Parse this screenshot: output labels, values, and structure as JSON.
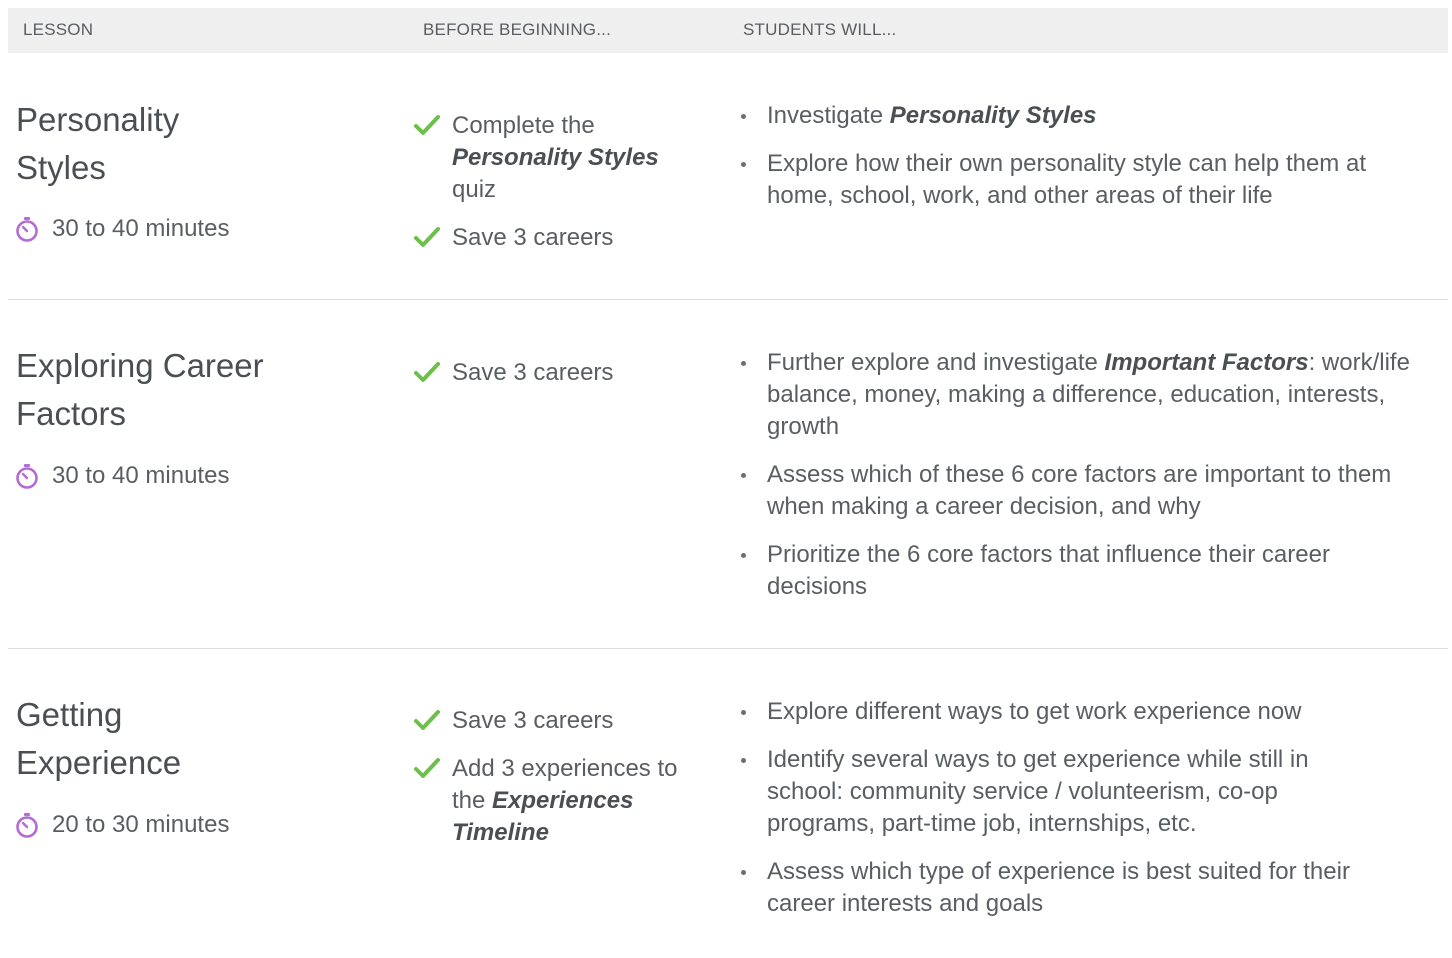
{
  "header": {
    "col_lesson": "LESSON",
    "col_before": "BEFORE BEGINNING...",
    "col_students": "STUDENTS WILL..."
  },
  "colors": {
    "check": "#6cc04a",
    "timer": "#b46bd6",
    "divider": "#dcdcdc",
    "header_bg": "#efefef"
  },
  "icons": {
    "check": "checkmark-icon",
    "timer": "stopwatch-icon",
    "bullet": "bullet-dot"
  },
  "lessons": [
    {
      "title_line1": "Personality",
      "title_line2": "Styles",
      "duration": "30 to 40 minutes",
      "prereqs": [
        {
          "pre": "Complete the",
          "em": "Personality Styles",
          "post": "quiz"
        },
        {
          "pre": "Save 3 careers",
          "em": "",
          "post": ""
        }
      ],
      "objectives": [
        {
          "pre": "Investigate ",
          "em": "Personality Styles",
          "post": ""
        },
        {
          "pre": "Explore how their own personality style can help them at home, school, work, and other areas of their life",
          "em": "",
          "post": ""
        }
      ]
    },
    {
      "title_line1": "Exploring Career",
      "title_line2": "Factors",
      "duration": "30 to 40 minutes",
      "prereqs": [
        {
          "pre": "Save 3 careers",
          "em": "",
          "post": ""
        }
      ],
      "objectives": [
        {
          "pre": "Further explore and investigate ",
          "em": "Important Factors",
          "post": ": work/life balance, money, making a difference, education, interests, growth"
        },
        {
          "pre": "Assess which of these 6 core factors are important to them when making a career decision, and why",
          "em": "",
          "post": ""
        },
        {
          "pre": "Prioritize the 6 core factors that influence their career decisions",
          "em": "",
          "post": ""
        }
      ]
    },
    {
      "title_line1": "Getting",
      "title_line2": "Experience",
      "duration": "20 to 30 minutes",
      "prereqs": [
        {
          "pre": "Save 3 careers",
          "em": "",
          "post": ""
        },
        {
          "pre": "Add 3 experiences to the ",
          "em": "Experiences Timeline",
          "post": ""
        }
      ],
      "objectives": [
        {
          "pre": "Explore different ways to get work experience now",
          "em": "",
          "post": ""
        },
        {
          "pre": "Identify several ways to get experience while still in school: community service / volunteerism, co-op programs, part-time job, internships, etc.",
          "em": "",
          "post": ""
        },
        {
          "pre": "Assess which type of experience is best suited for their career interests and goals",
          "em": "",
          "post": ""
        }
      ]
    }
  ]
}
